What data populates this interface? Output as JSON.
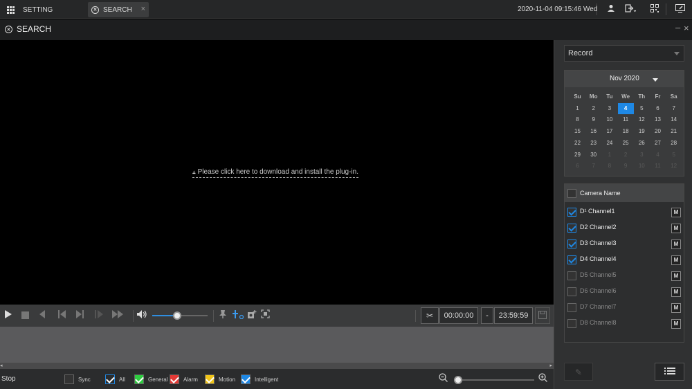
{
  "topbar": {
    "tabs": [
      {
        "label": "SETTING",
        "icon": "grid-icon"
      },
      {
        "label": "SEARCH",
        "icon": "search-circle-icon",
        "close": "×"
      }
    ],
    "datetime": "2020-11-04 09:15:46 Wed",
    "icons": [
      "user-icon",
      "logout-icon",
      "qrcode-icon",
      "monitor-icon"
    ]
  },
  "titlebar": {
    "title": "SEARCH",
    "minimize": "–",
    "close": "×"
  },
  "video": {
    "plugin_message": "Please click here to download and install the plug-in."
  },
  "controls": {
    "icons": [
      "play-icon",
      "stop-icon",
      "prev-icon",
      "prev-frame-icon",
      "next-frame-icon",
      "slow-icon",
      "fast-icon",
      "volume-icon",
      "pin-icon",
      "add-tag-icon",
      "snapshot-icon",
      "fullscreen-icon",
      "scissors-icon",
      "save-icon"
    ],
    "volume_level": 0.45,
    "time_start": "00:00:00",
    "time_dash": "-",
    "time_end": "23:59:59"
  },
  "bottombar": {
    "status": "Stop",
    "filters": [
      {
        "label": "Sync",
        "checked": false,
        "color": "#333333"
      },
      {
        "label": "All",
        "checked": true,
        "color": "#1e88e5"
      },
      {
        "label": "General",
        "checked": true,
        "color": "#2ecc40"
      },
      {
        "label": "Alarm",
        "checked": true,
        "color": "#e53935"
      },
      {
        "label": "Motion",
        "checked": true,
        "color": "#f0c419"
      },
      {
        "label": "Intelligent",
        "checked": true,
        "color": "#1e88e5"
      }
    ],
    "zoom_level": 0.0
  },
  "rightpanel": {
    "record_type": "Record",
    "calendar": {
      "month_label": "Nov 2020",
      "weekdays": [
        "Su",
        "Mo",
        "Tu",
        "We",
        "Th",
        "Fr",
        "Sa"
      ],
      "selected_day": "4",
      "days": [
        [
          "1",
          "2",
          "3",
          "4",
          "5",
          "6",
          "7"
        ],
        [
          "8",
          "9",
          "10",
          "11",
          "12",
          "13",
          "14"
        ],
        [
          "15",
          "16",
          "17",
          "18",
          "19",
          "20",
          "21"
        ],
        [
          "22",
          "23",
          "24",
          "25",
          "26",
          "27",
          "28"
        ],
        [
          "29",
          "30",
          "1",
          "2",
          "3",
          "4",
          "5"
        ],
        [
          "6",
          "7",
          "8",
          "9",
          "10",
          "11",
          "12"
        ]
      ],
      "other_month_start_index": 30
    },
    "camera_header": "Camera Name",
    "cameras": [
      {
        "name": "D¹ Channel1",
        "checked": true,
        "m": "M"
      },
      {
        "name": "D2 Channel2",
        "checked": true,
        "m": "M"
      },
      {
        "name": "D3 Channel3",
        "checked": true,
        "m": "M"
      },
      {
        "name": "D4 Channel4",
        "checked": true,
        "m": "M"
      },
      {
        "name": "D5 Channel5",
        "checked": false,
        "m": "M"
      },
      {
        "name": "D6 Channel6",
        "checked": false,
        "m": "M"
      },
      {
        "name": "D7 Channel7",
        "checked": false,
        "m": "M"
      },
      {
        "name": "D8 Channel8",
        "checked": false,
        "m": "M"
      }
    ]
  }
}
